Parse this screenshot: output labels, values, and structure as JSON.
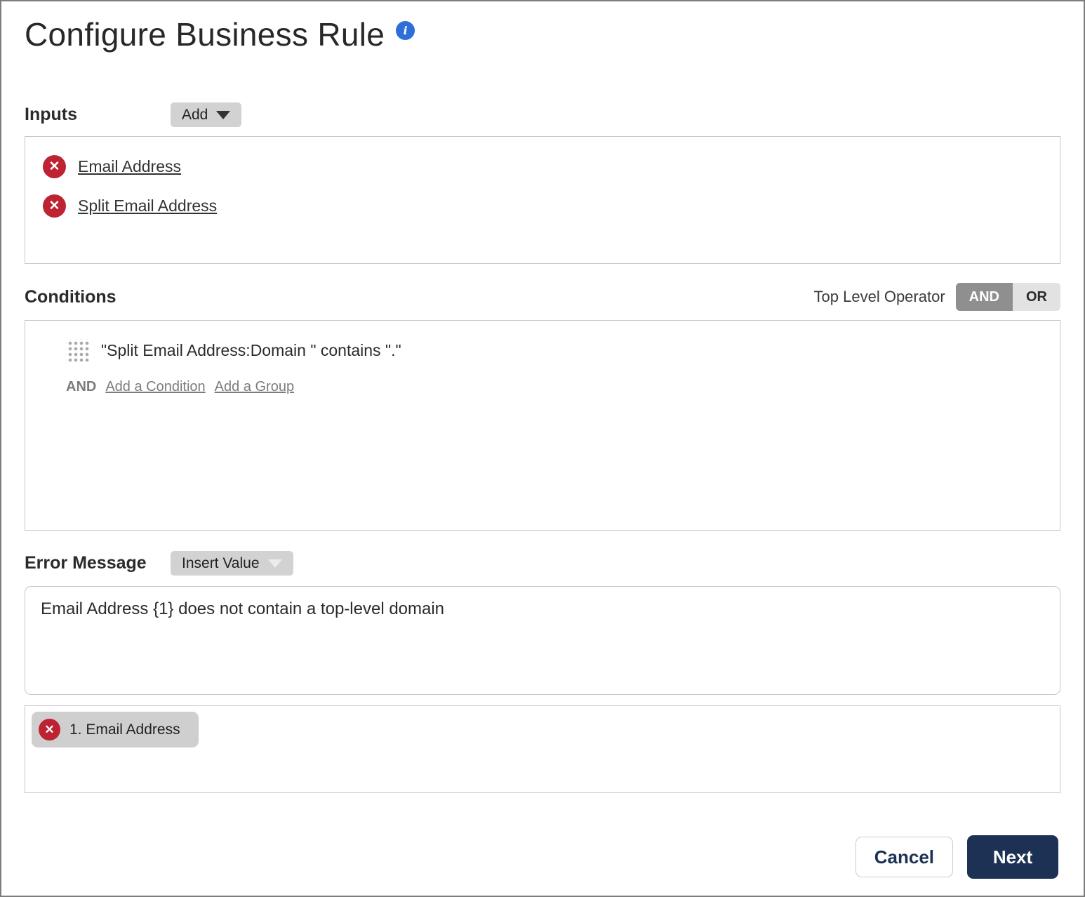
{
  "title": "Configure Business Rule",
  "inputs": {
    "label": "Inputs",
    "add_button_label": "Add",
    "items": [
      {
        "label": "Email Address"
      },
      {
        "label": "Split Email Address"
      }
    ]
  },
  "conditions": {
    "label": "Conditions",
    "top_level_operator_label": "Top Level Operator",
    "operators": {
      "and": "AND",
      "or": "OR",
      "selected": "AND"
    },
    "rows": [
      {
        "text": "\"Split Email Address:Domain \" contains \".\""
      }
    ],
    "connector": "AND",
    "add_condition_link": "Add a Condition",
    "add_group_link": "Add a Group"
  },
  "error_message": {
    "label": "Error Message",
    "insert_value_button_label": "Insert Value",
    "text": "Email Address {1} does not contain a top-level domain",
    "tokens": [
      {
        "label": "1. Email Address"
      }
    ]
  },
  "footer": {
    "cancel_label": "Cancel",
    "next_label": "Next"
  },
  "icons": {
    "info": "i",
    "delete": "✕"
  },
  "colors": {
    "danger_red": "#bd2333",
    "info_blue": "#2e6ed9",
    "accent_navy": "#1c3153",
    "button_gray": "#d2d2d2",
    "toggle_selected_gray": "#8f8f8f"
  }
}
